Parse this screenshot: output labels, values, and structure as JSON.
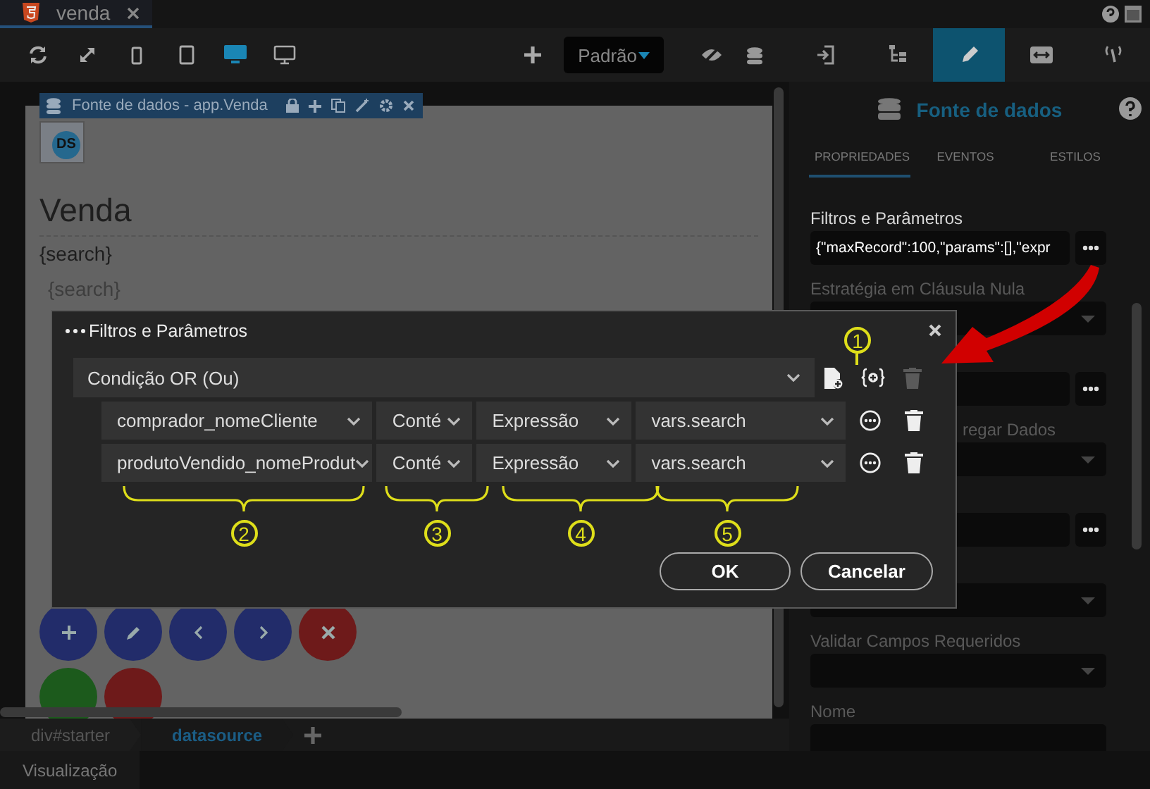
{
  "editor_tab": {
    "title": "venda",
    "selected": true
  },
  "toolbar": {
    "devices": [
      {
        "kind": "refresh",
        "selected": false
      },
      {
        "kind": "expand",
        "selected": false
      },
      {
        "kind": "phone",
        "selected": false
      },
      {
        "kind": "tablet",
        "selected": false
      },
      {
        "kind": "desktop",
        "selected": true
      },
      {
        "kind": "monitor",
        "selected": false
      }
    ],
    "theme_select": "Padrão"
  },
  "component_bar": {
    "title": "Fonte de dados - app.Venda",
    "badge": "DS"
  },
  "canvas": {
    "heading": "Venda",
    "text": "{search}",
    "search_placeholder": "{search}",
    "buttons": [
      {
        "kind": "plus",
        "color": "#222c6a"
      },
      {
        "kind": "pencil",
        "color": "#222c6a"
      },
      {
        "kind": "prev",
        "color": "#222c6a"
      },
      {
        "kind": "next",
        "color": "#222c6a"
      },
      {
        "kind": "close",
        "color": "#6e1a1a"
      },
      {
        "kind": "blank",
        "color": "#1c5a1c"
      },
      {
        "kind": "blank",
        "color": "#6e1a1a"
      }
    ]
  },
  "breadcrumbs": [
    {
      "label": "div#starter",
      "selected": false
    },
    {
      "label": "datasource",
      "selected": true
    }
  ],
  "bottom_tab": "Visualização",
  "panel": {
    "tabs": [
      {
        "kind": "import",
        "selected": false
      },
      {
        "kind": "tree",
        "selected": false
      },
      {
        "kind": "pencil",
        "selected": true
      },
      {
        "kind": "resize",
        "selected": false
      },
      {
        "kind": "code",
        "selected": false
      }
    ],
    "title": "Fonte de dados",
    "subtabs": [
      {
        "label": "PROPRIEDADES",
        "selected": true
      },
      {
        "label": "EVENTOS",
        "selected": false
      },
      {
        "label": "ESTILOS",
        "selected": false
      }
    ],
    "fields": [
      {
        "label": "Filtros e Parâmetros",
        "emphasized": true,
        "kind": "input_button",
        "value": "{\"maxRecord\":100,\"params\":[],\"expr"
      },
      {
        "label": "Estratégia em Cláusula Nula",
        "emphasized": false,
        "kind": "select"
      },
      {
        "kind": "input_button"
      },
      {
        "label": "regar Dados",
        "emphasized": false,
        "covered": true,
        "kind": "select"
      },
      {
        "kind": "input_button"
      },
      {
        "kind": "select"
      },
      {
        "label": "Validar Campos Requeridos",
        "emphasized": false,
        "kind": "select"
      },
      {
        "label": "Nome",
        "emphasized": false,
        "kind": "input"
      }
    ]
  },
  "dialog": {
    "title": "Filtros e Parâmetros",
    "condition": {
      "label": "Condição OR (Ou)",
      "delete_disabled": true
    },
    "rows": [
      {
        "field": "comprador_nomeCliente",
        "operator": "Conté",
        "type": "Expressão",
        "value": "vars.search"
      },
      {
        "field": "produtoVendido_nomeProdut",
        "operator": "Conté",
        "type": "Expressão",
        "value": "vars.search"
      }
    ],
    "buttons": [
      "OK",
      "Cancelar"
    ]
  },
  "annotations": [
    {
      "label": "1"
    },
    {
      "label": "2"
    },
    {
      "label": "3"
    },
    {
      "label": "4"
    },
    {
      "label": "5"
    }
  ]
}
